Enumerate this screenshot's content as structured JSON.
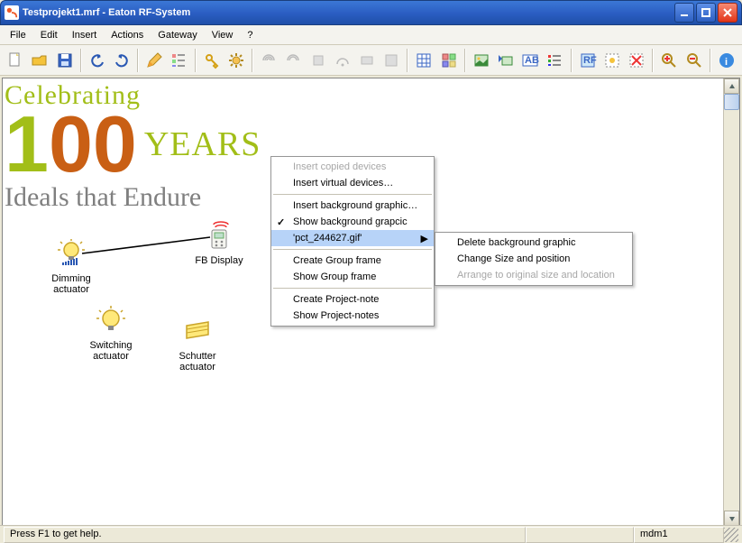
{
  "title": "Testprojekt1.mrf - Eaton RF-System",
  "menu": [
    "File",
    "Edit",
    "Insert",
    "Actions",
    "Gateway",
    "View",
    "?"
  ],
  "status": {
    "hint": "Press F1 to get help.",
    "port": "mdm1"
  },
  "celebrate": {
    "top": "Celebrating",
    "one": "1",
    "zz": "00",
    "years": "YEARS",
    "ideals": "Ideals that Endure"
  },
  "devices": {
    "dimming": "Dimming\nactuator",
    "switching": "Switching\nactuator",
    "schutter": "Schutter\nactuator",
    "fbdisplay": "FB Display"
  },
  "ctx1": {
    "insert_copied": "Insert copied devices",
    "insert_virtual": "Insert virtual devices…",
    "insert_bg": "Insert background graphic…",
    "show_bg": "Show background grapcic",
    "gif": "'pct_244627.gif'",
    "create_group": "Create Group frame",
    "show_group": "Show Group frame",
    "create_note": "Create Project-note",
    "show_notes": "Show Project-notes"
  },
  "ctx2": {
    "del": "Delete background graphic",
    "size": "Change Size and position",
    "arrange": "Arrange to original size and location"
  }
}
